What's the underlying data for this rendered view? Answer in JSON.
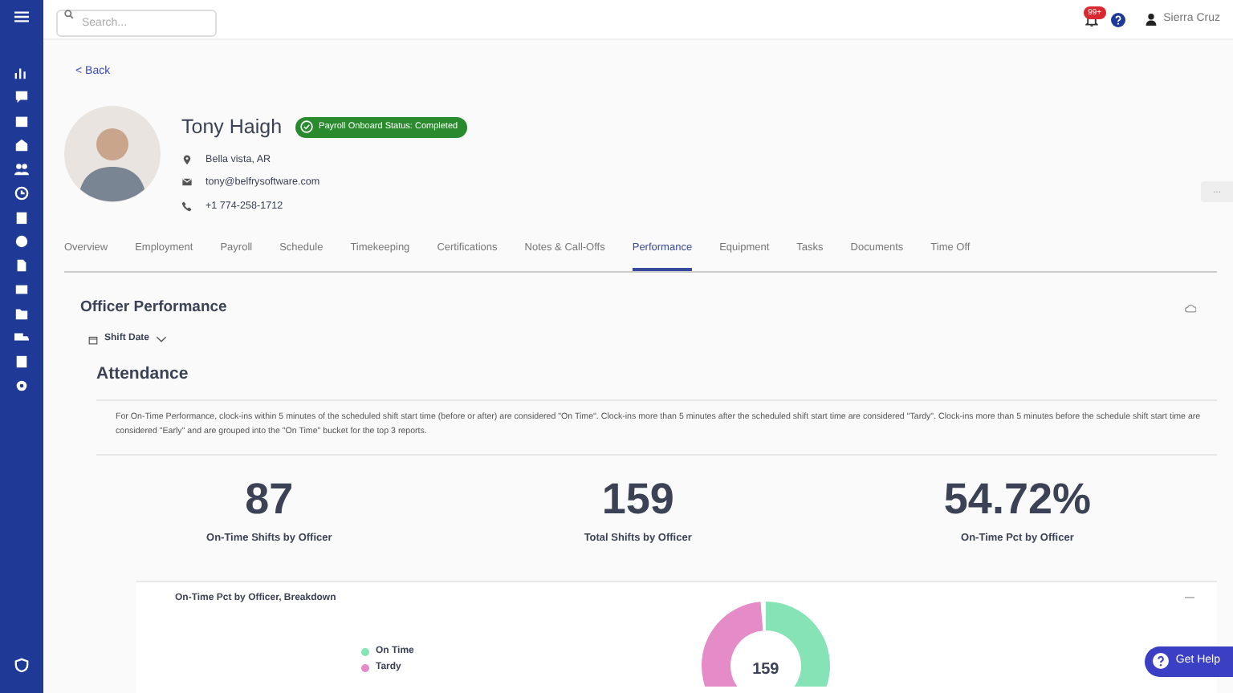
{
  "topbar": {
    "search": {
      "placeholder": "Search..."
    },
    "notification_badge": "99+",
    "user_name": "Sierra Cruz"
  },
  "back_link": "< Back",
  "profile": {
    "name": "Tony Haigh",
    "status_badge": "Payroll Onboard Status: Completed",
    "location": "Bella vista, AR",
    "email": "tony@belfrysoftware.com",
    "phone": "+1 774-258-1712",
    "menu_button": "..."
  },
  "tabs": [
    {
      "label": "Overview",
      "selected": false
    },
    {
      "label": "Employment",
      "selected": false
    },
    {
      "label": "Payroll",
      "selected": false
    },
    {
      "label": "Schedule",
      "selected": false
    },
    {
      "label": "Timekeeping",
      "selected": false
    },
    {
      "label": "Certifications",
      "selected": false
    },
    {
      "label": "Notes & Call-Offs",
      "selected": false
    },
    {
      "label": "Performance",
      "selected": true
    },
    {
      "label": "Equipment",
      "selected": false
    },
    {
      "label": "Tasks",
      "selected": false
    },
    {
      "label": "Documents",
      "selected": false
    },
    {
      "label": "Time Off",
      "selected": false
    }
  ],
  "report": {
    "title": "Officer Performance",
    "filter": "Shift Date",
    "section_title": "Attendance",
    "description": "For On-Time Performance, clock-ins within 5 minutes of the scheduled shift start time (before or after) are considered \"On Time\". Clock-ins more than 5 minutes after the scheduled shift start time are considered \"Tardy\". Clock-ins more than 5 minutes before the schedule shift start time are considered \"Early\" and are grouped into the \"On Time\" bucket for the top 3 reports.",
    "stats": [
      {
        "value": "87",
        "label": "On-Time Shifts by Officer"
      },
      {
        "value": "159",
        "label": "Total Shifts by Officer"
      },
      {
        "value": "54.72%",
        "label": "On-Time Pct by Officer"
      }
    ],
    "breakdown": {
      "title": "On-Time Pct by Officer, Breakdown",
      "center_label": "159",
      "legend": [
        {
          "label": "On Time",
          "color": "#86e3b5"
        },
        {
          "label": "Tardy",
          "color": "#e58cc8"
        }
      ]
    }
  },
  "help_button": "Get Help"
}
